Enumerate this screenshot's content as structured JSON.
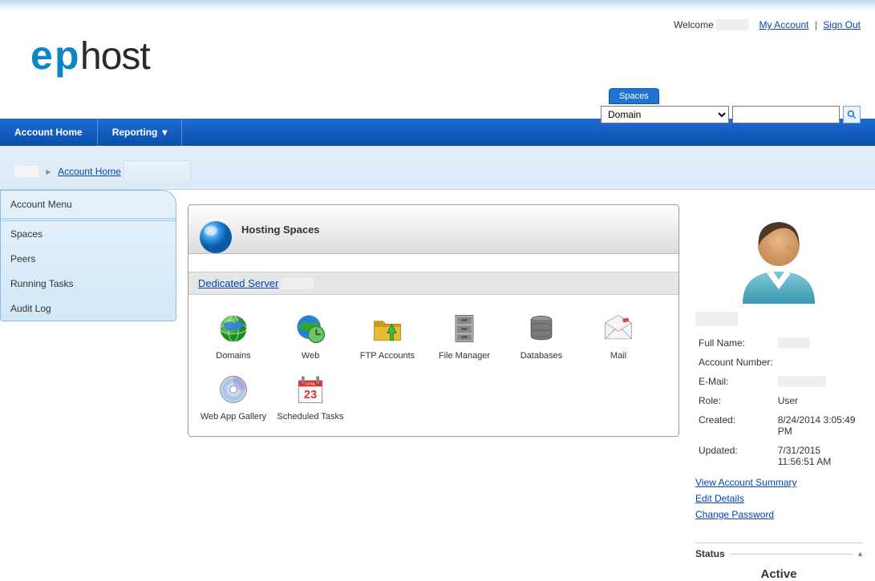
{
  "header": {
    "welcome": "Welcome",
    "my_account": "My Account",
    "sign_out": "Sign Out",
    "spaces_tab": "Spaces",
    "search_selected": "Domain"
  },
  "nav": {
    "account_home": "Account Home",
    "reporting": "Reporting"
  },
  "breadcrumb": {
    "current": "Account Home"
  },
  "sidebar": {
    "title": "Account Menu",
    "items": [
      "Spaces",
      "Peers",
      "Running Tasks",
      "Audit Log"
    ]
  },
  "panel": {
    "title": "Hosting Spaces",
    "server_label": "Dedicated Server"
  },
  "icons": [
    {
      "label": "Domains",
      "key": "domains"
    },
    {
      "label": "Web",
      "key": "web"
    },
    {
      "label": "FTP Accounts",
      "key": "ftp"
    },
    {
      "label": "File Manager",
      "key": "filemgr"
    },
    {
      "label": "Databases",
      "key": "db"
    },
    {
      "label": "Mail",
      "key": "mail"
    },
    {
      "label": "Web App Gallery",
      "key": "gallery"
    },
    {
      "label": "Scheduled Tasks",
      "key": "schedule"
    }
  ],
  "account": {
    "fields": {
      "full_name_label": "Full Name:",
      "account_number_label": "Account Number:",
      "email_label": "E-Mail:",
      "role_label": "Role:",
      "created_label": "Created:",
      "updated_label": "Updated:"
    },
    "role": "User",
    "created": "8/24/2014 3:05:49 PM",
    "updated": "7/31/2015 11:56:51 AM",
    "links": {
      "view_summary": "View Account Summary",
      "edit_details": "Edit Details",
      "change_password": "Change Password"
    },
    "status_label": "Status",
    "status_value": "Active"
  }
}
